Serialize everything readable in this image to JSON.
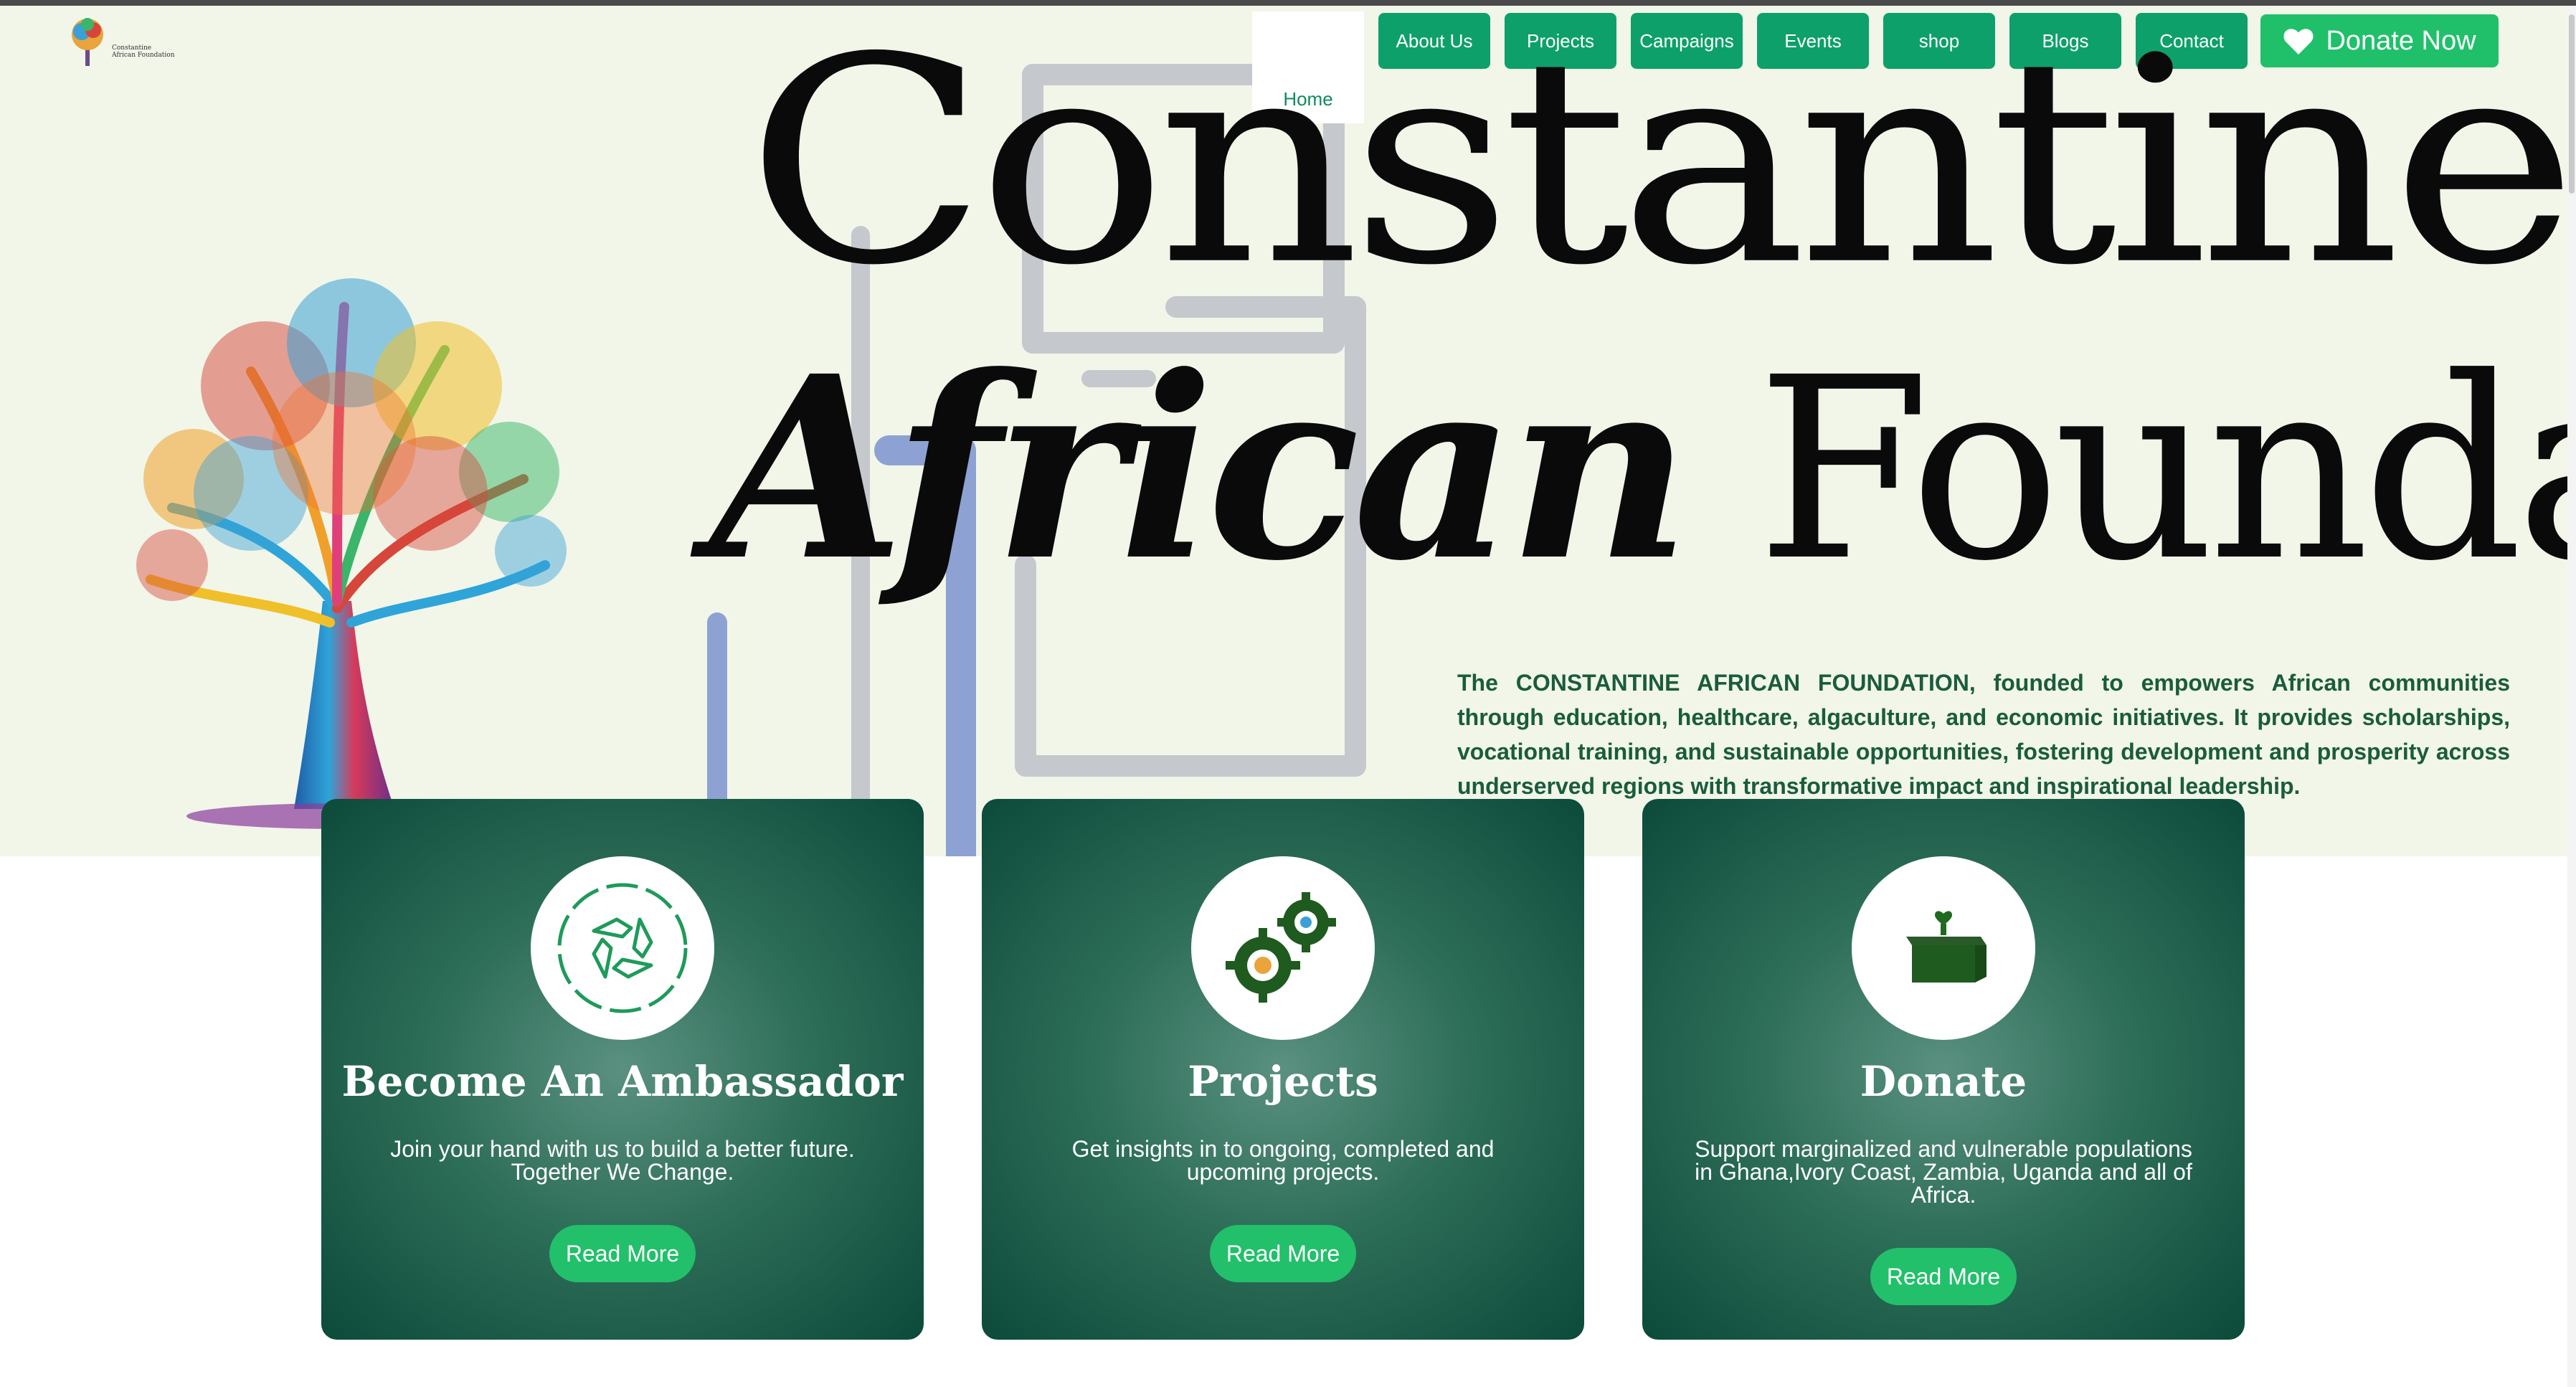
{
  "brand": {
    "logo_text_line1": "Constantine",
    "logo_text_line2": "African Foundation"
  },
  "nav": {
    "items": [
      {
        "label": "About Us"
      },
      {
        "label": "Projects"
      },
      {
        "label": "Campaigns"
      },
      {
        "label": "Events"
      },
      {
        "label": "shop"
      },
      {
        "label": "Blogs"
      },
      {
        "label": "Contact"
      }
    ],
    "home_label": "Home",
    "donate_label": "Donate Now"
  },
  "hero": {
    "title_line1": "Constantine",
    "title_africa": "African",
    "title_foundation": "Foundation",
    "intro": "The CONSTANTINE AFRICAN FOUNDATION, founded to empowers African communities through education, healthcare, algaculture, and economic initiatives. It provides scholarships, vocational training, and sustainable opportunities, fostering development and prosperity across underserved regions with transformative impact and inspirational leadership."
  },
  "cards": [
    {
      "title": "Become An Ambassador",
      "text": "Join your hand with us to build a better future. Together We Change.",
      "button": "Read More",
      "icon": "handshake-circle-icon"
    },
    {
      "title": "Projects",
      "text": "Get insights in to ongoing, completed and upcoming projects.",
      "button": "Read More",
      "icon": "gears-icon"
    },
    {
      "title": "Donate",
      "text": "Support marginalized and vulnerable populations in Ghana,Ivory Coast, Zambia, Uganda and all of Africa.",
      "button": "Read More",
      "icon": "donation-box-icon"
    }
  ],
  "colors": {
    "hero_bg": "#f1f6e9",
    "nav_green": "#0ea06a",
    "donate_green": "#20c06a",
    "card_dark": "#0c4a3a",
    "intro_text": "#1a5c3c"
  }
}
